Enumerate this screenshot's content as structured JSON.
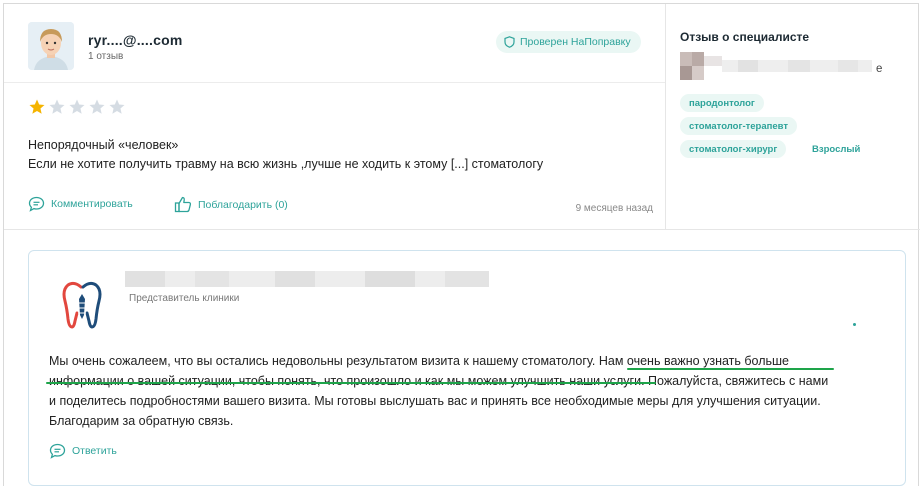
{
  "review": {
    "user_name": "ryr....@....com",
    "review_count": "1 отзыв",
    "verified_label": "Проверен НаПоправку",
    "rating": 1,
    "rating_max": 5,
    "title": "Непорядочный «человек»",
    "text": "Если не хотите получить травму на всю жизнь ,лучше не ходить к этому [...] стоматологу",
    "comment_label": "Комментировать",
    "thanks_label": "Поблагодарить (0)",
    "time_ago": "9 месяцев назад"
  },
  "specialist": {
    "title": "Отзыв о специалисте",
    "name_suffix": "е",
    "tags": [
      "пародонтолог",
      "стоматолог-терапевт",
      "стоматолог-хирург"
    ],
    "age_group": "Взрослый"
  },
  "reply": {
    "role": "Представитель клиники",
    "line1_a": "Мы очень сожалеем, что вы остались недовольны результатом визита к нашему стоматологу. ",
    "line1_b": "Нам очень важно узнать больше",
    "line2_a": "информации о вашей ситуации, чтобы понять, что произошло и как мы можем улучшить наши услуги.",
    "line2_b": " Пожалуйста, свяжитесь с нами",
    "line3": "и поделитесь подробностями вашего визита. Мы готовы выслушать вас и принять все необходимые меры для улучшения ситуации.",
    "line4": "Благодарим за обратную связь.",
    "reply_label": "Ответить"
  },
  "colors": {
    "accent": "#2ea39a",
    "star_filled": "#f5b400",
    "star_empty": "#d5dce3",
    "highlight": "#1ea44a"
  }
}
